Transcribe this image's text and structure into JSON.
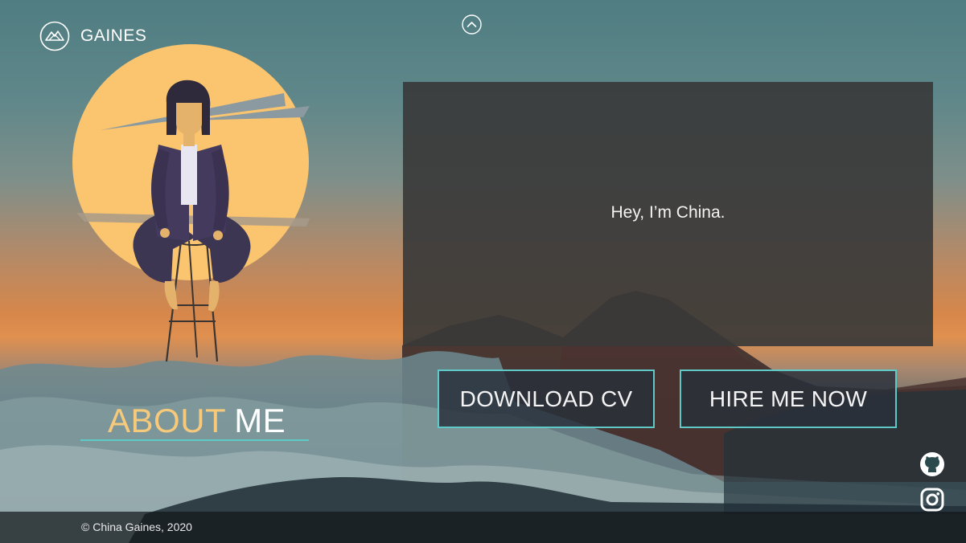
{
  "header": {
    "logo_icon": "mountain-logo-icon",
    "brand": "GAINES",
    "scroll_up_icon": "chevron-up-icon"
  },
  "hero": {
    "intro": "Hey, I’m China.",
    "illustration": "woman-on-stool-illustration"
  },
  "buttons": {
    "download_cv": "DOWNLOAD CV",
    "hire_me": "HIRE ME NOW"
  },
  "section": {
    "title_part1": "ABOUT",
    "title_part2": "ME"
  },
  "social": {
    "github_icon": "github-icon",
    "instagram_icon": "instagram-icon"
  },
  "footer": {
    "copyright": "© China Gaines, 2020"
  },
  "colors": {
    "accent_teal": "#5ec9c6",
    "accent_yellow": "#f7c97b",
    "card_bg": "#3a3a3a"
  }
}
